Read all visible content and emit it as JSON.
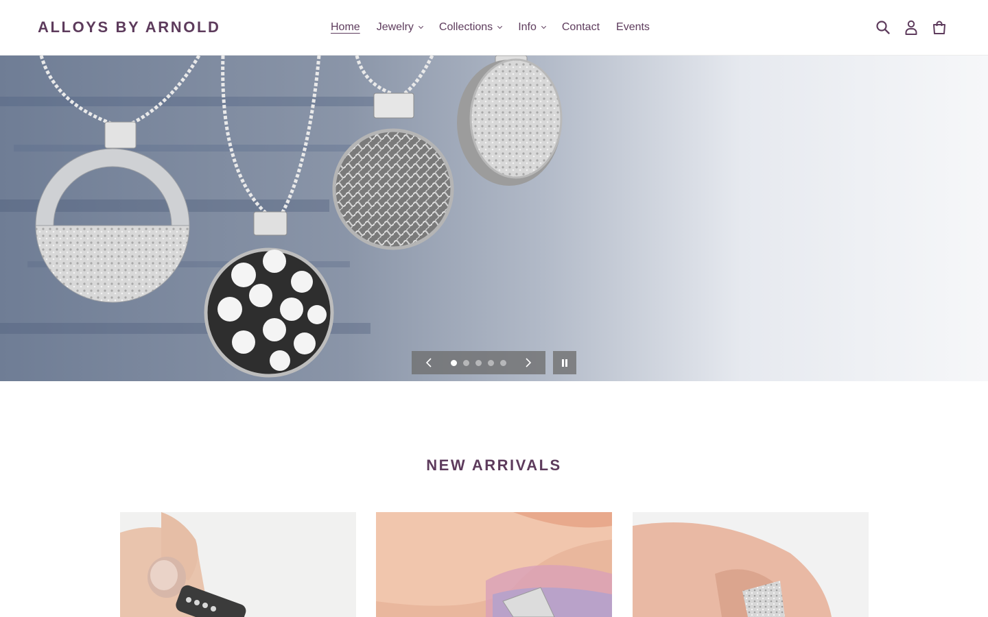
{
  "header": {
    "logo": "ALLOYS BY ARNOLD",
    "nav": [
      {
        "label": "Home",
        "active": true,
        "dropdown": false
      },
      {
        "label": "Jewelry",
        "active": false,
        "dropdown": true
      },
      {
        "label": "Collections",
        "active": false,
        "dropdown": true
      },
      {
        "label": "Info",
        "active": false,
        "dropdown": true
      },
      {
        "label": "Contact",
        "active": false,
        "dropdown": false
      },
      {
        "label": "Events",
        "active": false,
        "dropdown": false
      }
    ],
    "icons": [
      "search-icon",
      "account-icon",
      "cart-icon"
    ]
  },
  "hero": {
    "slide_count": 5,
    "active_slide": 1,
    "controls": {
      "prev_icon": "chevron-left-icon",
      "next_icon": "chevron-right-icon",
      "pause_icon": "pause-icon"
    }
  },
  "new_arrivals": {
    "title": "NEW ARRIVALS",
    "products": [
      {
        "image": "ring-held-between-fingers"
      },
      {
        "image": "textured-ring-on-finger"
      },
      {
        "image": "wide-textured-ring-on-hand"
      }
    ]
  },
  "colors": {
    "brand": "#5d3b5c",
    "header_bg": "#ffffff",
    "control_bg": "#6e6e6e"
  }
}
